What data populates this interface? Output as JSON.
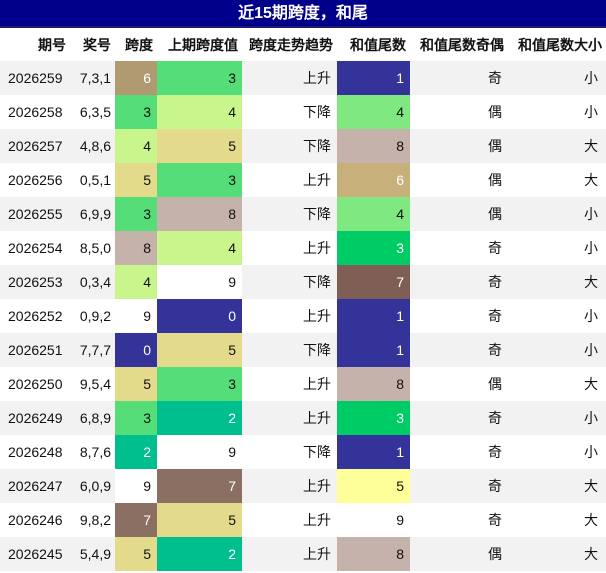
{
  "title": "近15期跨度，和尾",
  "columns": [
    "期号",
    "奖号",
    "跨度",
    "上期跨度值",
    "跨度走势趋势",
    "和值尾数",
    "和值尾数奇偶",
    "和值尾数大小"
  ],
  "colors": {
    "0": "#333399",
    "1": "#333399",
    "2": "#00bf8f",
    "3": "#55dd77",
    "4": "#c8f58c",
    "5": "#e3da8c",
    "6": "#b09a72",
    "7": "#8a6f62",
    "8": "#c4b2ab",
    "9": "#ffffff"
  },
  "tail_colors": {
    "1": "#333399",
    "3": "#00cc66",
    "4": "#80e880",
    "5": "#ffff99",
    "6": "#c8b07a",
    "7": "#7f5f55",
    "8": "#c4b2ab",
    "9": "#ffffff"
  },
  "rows": [
    {
      "period": "2026259",
      "nums": "7,3,1",
      "span": "6",
      "prev": "3",
      "trend": "上升",
      "tail": "1",
      "parity": "奇",
      "size": "小"
    },
    {
      "period": "2026258",
      "nums": "6,3,5",
      "span": "3",
      "prev": "4",
      "trend": "下降",
      "tail": "4",
      "parity": "偶",
      "size": "小"
    },
    {
      "period": "2026257",
      "nums": "4,8,6",
      "span": "4",
      "prev": "5",
      "trend": "下降",
      "tail": "8",
      "parity": "偶",
      "size": "大"
    },
    {
      "period": "2026256",
      "nums": "0,5,1",
      "span": "5",
      "prev": "3",
      "trend": "上升",
      "tail": "6",
      "parity": "偶",
      "size": "大"
    },
    {
      "period": "2026255",
      "nums": "6,9,9",
      "span": "3",
      "prev": "8",
      "trend": "下降",
      "tail": "4",
      "parity": "偶",
      "size": "小"
    },
    {
      "period": "2026254",
      "nums": "8,5,0",
      "span": "8",
      "prev": "4",
      "trend": "上升",
      "tail": "3",
      "parity": "奇",
      "size": "小"
    },
    {
      "period": "2026253",
      "nums": "0,3,4",
      "span": "4",
      "prev": "9",
      "trend": "下降",
      "tail": "7",
      "parity": "奇",
      "size": "大"
    },
    {
      "period": "2026252",
      "nums": "0,9,2",
      "span": "9",
      "prev": "0",
      "trend": "上升",
      "tail": "1",
      "parity": "奇",
      "size": "小"
    },
    {
      "period": "2026251",
      "nums": "7,7,7",
      "span": "0",
      "prev": "5",
      "trend": "下降",
      "tail": "1",
      "parity": "奇",
      "size": "小"
    },
    {
      "period": "2026250",
      "nums": "9,5,4",
      "span": "5",
      "prev": "3",
      "trend": "上升",
      "tail": "8",
      "parity": "偶",
      "size": "大"
    },
    {
      "period": "2026249",
      "nums": "6,8,9",
      "span": "3",
      "prev": "2",
      "trend": "上升",
      "tail": "3",
      "parity": "奇",
      "size": "小"
    },
    {
      "period": "2026248",
      "nums": "8,7,6",
      "span": "2",
      "prev": "9",
      "trend": "下降",
      "tail": "1",
      "parity": "奇",
      "size": "小"
    },
    {
      "period": "2026247",
      "nums": "6,0,9",
      "span": "9",
      "prev": "7",
      "trend": "上升",
      "tail": "5",
      "parity": "奇",
      "size": "大"
    },
    {
      "period": "2026246",
      "nums": "9,8,2",
      "span": "7",
      "prev": "5",
      "trend": "上升",
      "tail": "9",
      "parity": "奇",
      "size": "大"
    },
    {
      "period": "2026245",
      "nums": "5,4,9",
      "span": "5",
      "prev": "2",
      "trend": "上升",
      "tail": "8",
      "parity": "偶",
      "size": "大"
    }
  ]
}
